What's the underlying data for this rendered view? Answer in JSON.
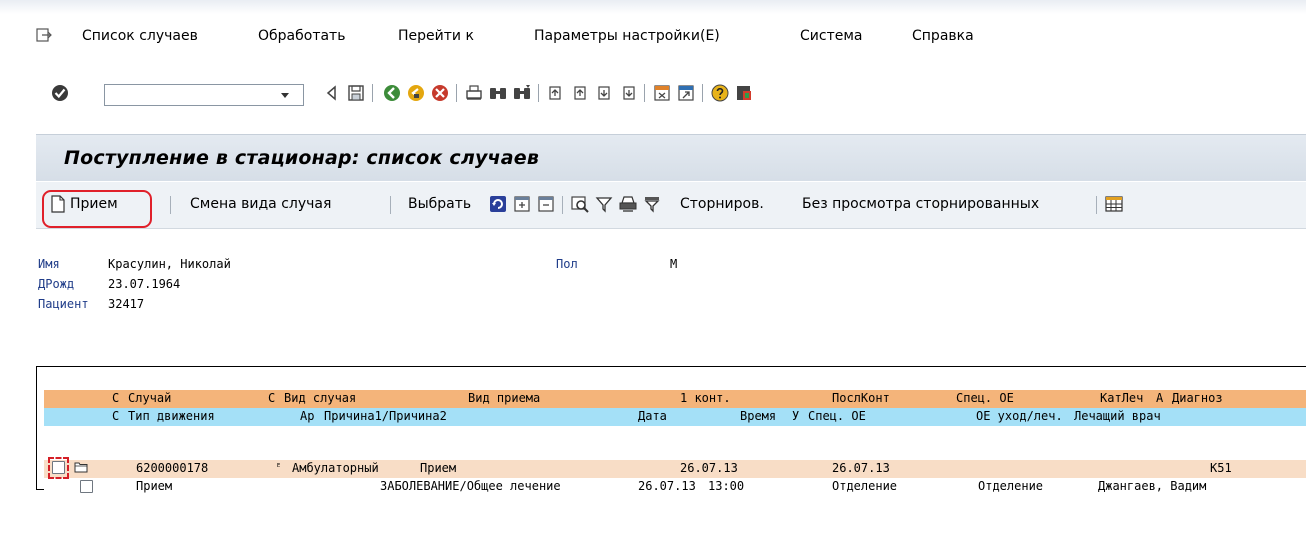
{
  "menu": {
    "items": [
      {
        "label": "Список случаев"
      },
      {
        "label": "Обработать"
      },
      {
        "label": "Перейти к"
      },
      {
        "label": "Параметры настройки(E)"
      },
      {
        "label": "Система"
      },
      {
        "label": "Справка"
      }
    ]
  },
  "toolbar": {
    "command_value": "",
    "icons": [
      "enter-icon",
      "back-icon",
      "save-icon",
      "green-back-icon",
      "exit-icon",
      "cancel-icon",
      "print-icon",
      "find-icon",
      "find-next-icon",
      "first-page-icon",
      "prev-page-icon",
      "next-page-icon",
      "last-page-icon",
      "new-session-icon",
      "shortcut-icon",
      "help-icon",
      "layout-icon"
    ]
  },
  "screen": {
    "title": "Поступление в стационар: список случаев"
  },
  "app_toolbar": {
    "admit_label": "Прием",
    "change_type_label": "Смена вида случая",
    "select_label": "Выбрать",
    "cancel_label": "Сторниров.",
    "no_cancelled_label": "Без просмотра сторнированных"
  },
  "patient": {
    "name_label": "Имя",
    "name_value": "Красулин, Николай",
    "sex_label": "Пол",
    "sex_value": "М",
    "dob_label": "ДРожд",
    "dob_value": "23.07.1964",
    "patient_label": "Пациент",
    "patient_value": "32417"
  },
  "table": {
    "header1": {
      "c1": "С",
      "case": "Случай",
      "c2": "С",
      "case_type": "Вид случая",
      "admission_type": "Вид приема",
      "first_contact": "1 конт.",
      "last_contact": "ПослКонт",
      "spec_ou": "Спец. ОЕ",
      "treat_cat": "КатЛеч",
      "a": "А",
      "diagnosis": "Диагноз"
    },
    "header2": {
      "c": "С",
      "movement_type": "Тип движения",
      "ar": "Ар",
      "reason": "Причина1/Причина2",
      "date": "Дата",
      "time": "Время",
      "u": "У",
      "spec_ou": "Спец. ОЕ",
      "care_ou": "ОЕ уход/леч.",
      "doctor": "Лечащий врач"
    },
    "row1": {
      "case": "6200000178",
      "flag": "ᴱ",
      "case_type": "Амбулаторный",
      "admission_type": "Прием",
      "first_contact": "26.07.13",
      "last_contact": "26.07.13",
      "diagnosis": "К51"
    },
    "row2": {
      "movement_type": "Прием",
      "reason": "ЗАБОЛЕВАНИЕ/Общее лечение",
      "date": "26.07.13",
      "time": "13:00",
      "spec_ou": "Отделение",
      "care_ou": "Отделение",
      "doctor": "Джангаев, Вадим"
    }
  }
}
